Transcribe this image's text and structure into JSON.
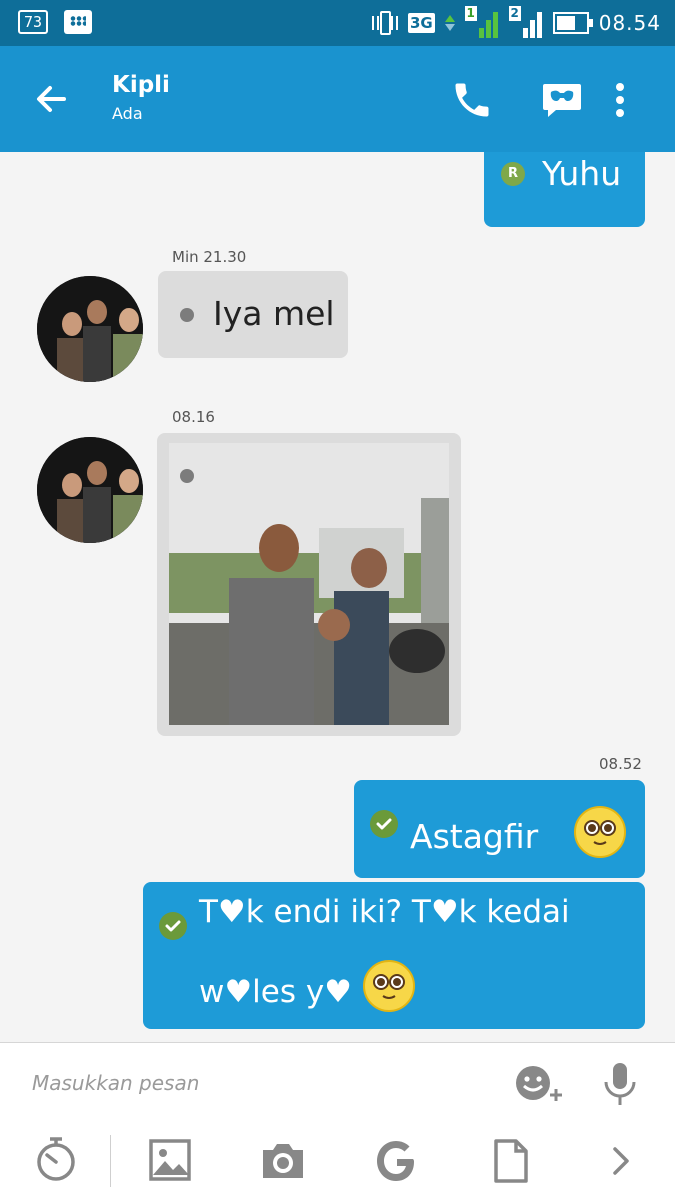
{
  "status_bar": {
    "battery_badge": "73",
    "signal_1": "1",
    "signal_2": "2",
    "network": "3G",
    "time": "08.54"
  },
  "header": {
    "contact_name": "Kipli",
    "contact_status": "Ada",
    "icons": [
      "back-arrow-icon",
      "phone-icon",
      "bbm-video-icon",
      "more-vert-icon"
    ]
  },
  "messages": [
    {
      "direction": "out",
      "status": "R",
      "text": "Yuhu"
    },
    {
      "direction": "in",
      "timestamp": "Min 21.30",
      "text": "Iya mel"
    },
    {
      "direction": "in",
      "timestamp": "08.16",
      "type": "photo"
    },
    {
      "direction": "out",
      "timestamp": "08.52",
      "status": "delivered",
      "text": "Astagfir"
    },
    {
      "direction": "out",
      "status": "delivered",
      "text_line1": "T♥k endi iki? T♥k kedai",
      "text_line2": "w♥les y♥"
    }
  ],
  "input": {
    "placeholder": "Masukkan pesan"
  },
  "toolbar": {
    "icons": [
      "timer-icon",
      "gallery-icon",
      "camera-icon",
      "google-icon",
      "file-icon",
      "chevron-right-icon",
      "emoji-add-icon",
      "microphone-icon"
    ]
  },
  "colors": {
    "status_bar": "#0e6e99",
    "app_bar": "#1a93cf",
    "outgoing_bubble": "#1e9bd7",
    "incoming_bubble": "#dcdcdc",
    "background": "#f4f4f4"
  }
}
